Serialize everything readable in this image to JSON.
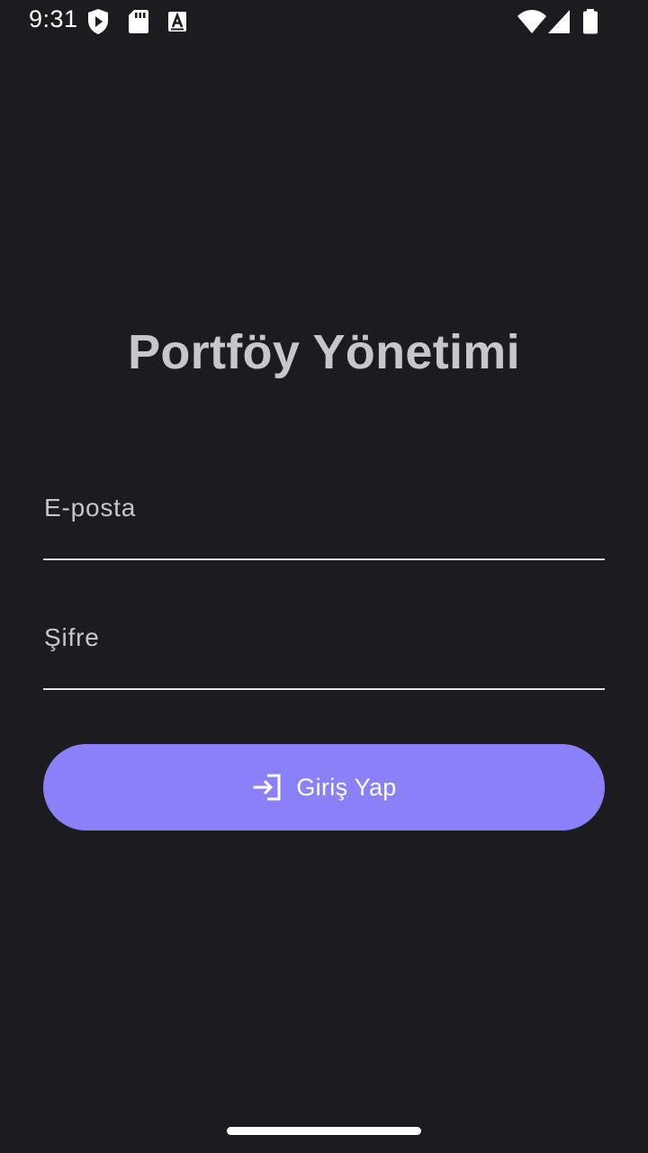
{
  "status_bar": {
    "time": "9:31",
    "left_icons": [
      "shield-play-icon",
      "sd-card-icon",
      "font-a-icon"
    ],
    "right_icons": [
      "wifi-icon",
      "cell-signal-icon",
      "battery-icon"
    ]
  },
  "app": {
    "title": "Portföy Yönetimi"
  },
  "form": {
    "email": {
      "label": "E-posta",
      "value": ""
    },
    "password": {
      "label": "Şifre",
      "value": ""
    },
    "login_button": {
      "label": "Giriş Yap",
      "icon": "login-icon"
    }
  },
  "colors": {
    "background": "#1c1b1f",
    "accent": "#8a80f8",
    "title": "#c8c6ca",
    "underline": "#e6e1e5"
  }
}
